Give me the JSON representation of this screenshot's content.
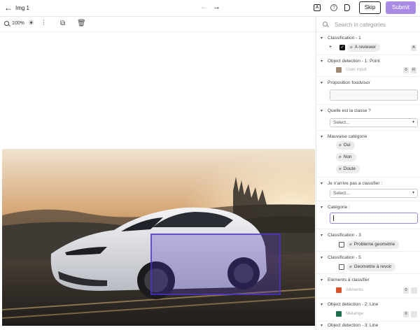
{
  "topbar": {
    "back_glyph": "←",
    "title": "Img 1",
    "prev_glyph": "←",
    "next_glyph": "→",
    "skip_label": "Skip",
    "submit_label": "Submit",
    "icons": [
      "back-arrow-icon",
      "prev-arrow-icon",
      "next-arrow-icon",
      "a-box-icon",
      "help-icon",
      "tag-icon"
    ]
  },
  "toolbar": {
    "zoom": "100%",
    "icons": [
      "zoom-icon",
      "brightness-icon",
      "adjust-sliders-icon",
      "copy-icon",
      "trash-icon"
    ],
    "glyphs": {
      "brightness": "☀",
      "adjust": "⫶",
      "copy": "⧉",
      "trash": "🗑"
    }
  },
  "search": {
    "placeholder": "Search in categories"
  },
  "sections": {
    "classification_1": {
      "title": "Classification - 1",
      "item_label": "A reviewer",
      "shortcut": "A"
    },
    "object_detection_1": {
      "title": "Object detection - 1: Point",
      "item_label": "User input",
      "count": "0",
      "shortcut": "R"
    },
    "proposition_foodvisor": {
      "title": "Proposition foodvisor"
    },
    "quelle_classe": {
      "title": "Quelle est la classe ?",
      "select_value": "Select..."
    },
    "mauvaise_categorie": {
      "title": "Mauvaise catégorie",
      "options": [
        "Oui",
        "Non",
        "Doute"
      ]
    },
    "je_narrive_pas": {
      "title": "Je n'arrive pas a classifier :",
      "select_value": "Select..."
    },
    "categorie": {
      "title": "Catégorie :"
    },
    "classification_3": {
      "title": "Classification - 3",
      "item_label": "Probleme geometrie"
    },
    "classification_5": {
      "title": "Classification - 5",
      "item_label": "Geometrie à revoir"
    },
    "elements_a_classifier": {
      "title": "Elements à classifier",
      "item_label": "Aliments",
      "count": "0"
    },
    "object_detection_2": {
      "title": "Object detection - 2: Line",
      "item_label": "Melange",
      "count": "0"
    },
    "object_detection_3": {
      "title": "Object detection - 3: Line"
    }
  },
  "colors": {
    "accent": "#a98be6",
    "bbox": "#4a33c7",
    "user_input_swatch": "#a08a76",
    "aliments_swatch": "#d9532c",
    "melange_swatch": "#1f6e4e"
  }
}
